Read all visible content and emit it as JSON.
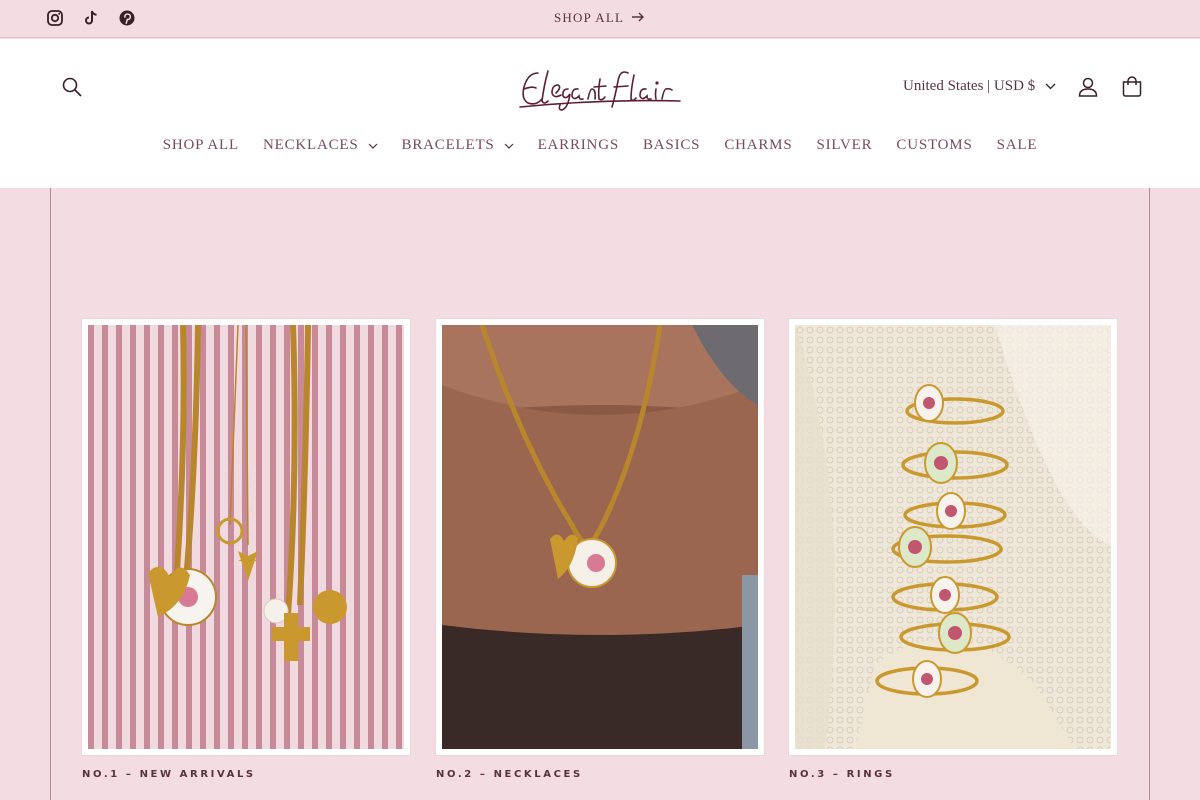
{
  "announcement": {
    "social_icons": [
      "instagram-icon",
      "tiktok-icon",
      "pinterest-icon"
    ],
    "link_label": "SHOP ALL"
  },
  "header": {
    "logo_text": "Elegant flair",
    "country_selector": "United States | USD $"
  },
  "nav": {
    "items": [
      {
        "label": "SHOP ALL",
        "dropdown": false
      },
      {
        "label": "NECKLACES",
        "dropdown": true
      },
      {
        "label": "BRACELETS",
        "dropdown": true
      },
      {
        "label": "EARRINGS",
        "dropdown": false
      },
      {
        "label": "BASICS",
        "dropdown": false
      },
      {
        "label": "CHARMS",
        "dropdown": false
      },
      {
        "label": "SILVER",
        "dropdown": false
      },
      {
        "label": "CUSTOMS",
        "dropdown": false
      },
      {
        "label": "SALE",
        "dropdown": false
      }
    ]
  },
  "collections": [
    {
      "caption": "NO.1 – NEW ARRIVALS"
    },
    {
      "caption": "NO.2 – NECKLACES"
    },
    {
      "caption": "NO.3 – RINGS"
    }
  ],
  "colors": {
    "brand_pink": "#f3dde3",
    "text_plum": "#6b3a4a",
    "logo": "#5a1f35"
  }
}
